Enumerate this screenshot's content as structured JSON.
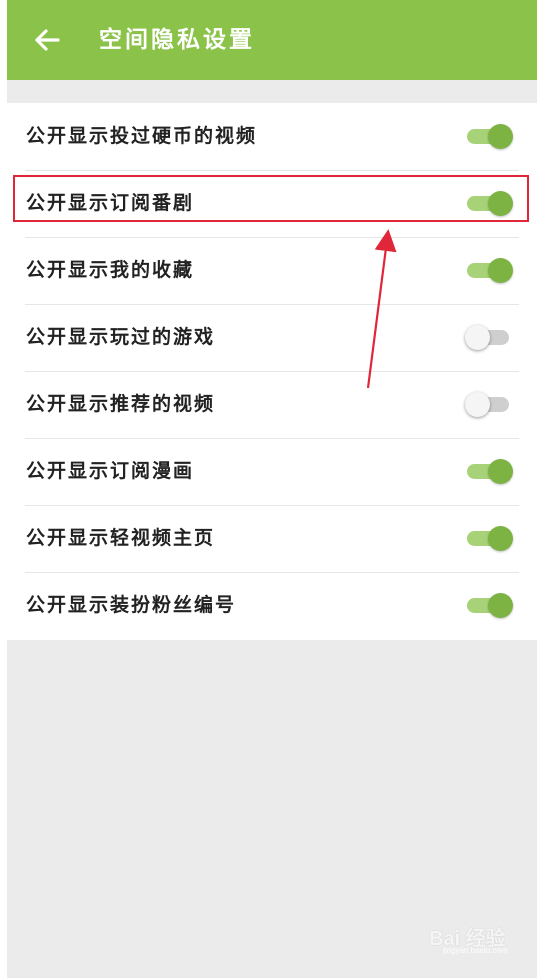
{
  "header": {
    "title": "空间隐私设置",
    "back_icon": "arrow-left-icon"
  },
  "settings": [
    {
      "label": "公开显示投过硬币的视频",
      "enabled": true
    },
    {
      "label": "公开显示订阅番剧",
      "enabled": true
    },
    {
      "label": "公开显示我的收藏",
      "enabled": true
    },
    {
      "label": "公开显示玩过的游戏",
      "enabled": false
    },
    {
      "label": "公开显示推荐的视频",
      "enabled": false
    },
    {
      "label": "公开显示订阅漫画",
      "enabled": true
    },
    {
      "label": "公开显示轻视频主页",
      "enabled": true
    },
    {
      "label": "公开显示装扮粉丝编号",
      "enabled": true
    }
  ],
  "annotation": {
    "highlighted_item": "公开显示订阅番剧",
    "color": "#e0273a"
  },
  "watermark": {
    "text": "Bai 经验",
    "sub": "jingyan.baidu.com"
  },
  "colors": {
    "accent": "#8bc34a",
    "background": "#ebebeb"
  }
}
